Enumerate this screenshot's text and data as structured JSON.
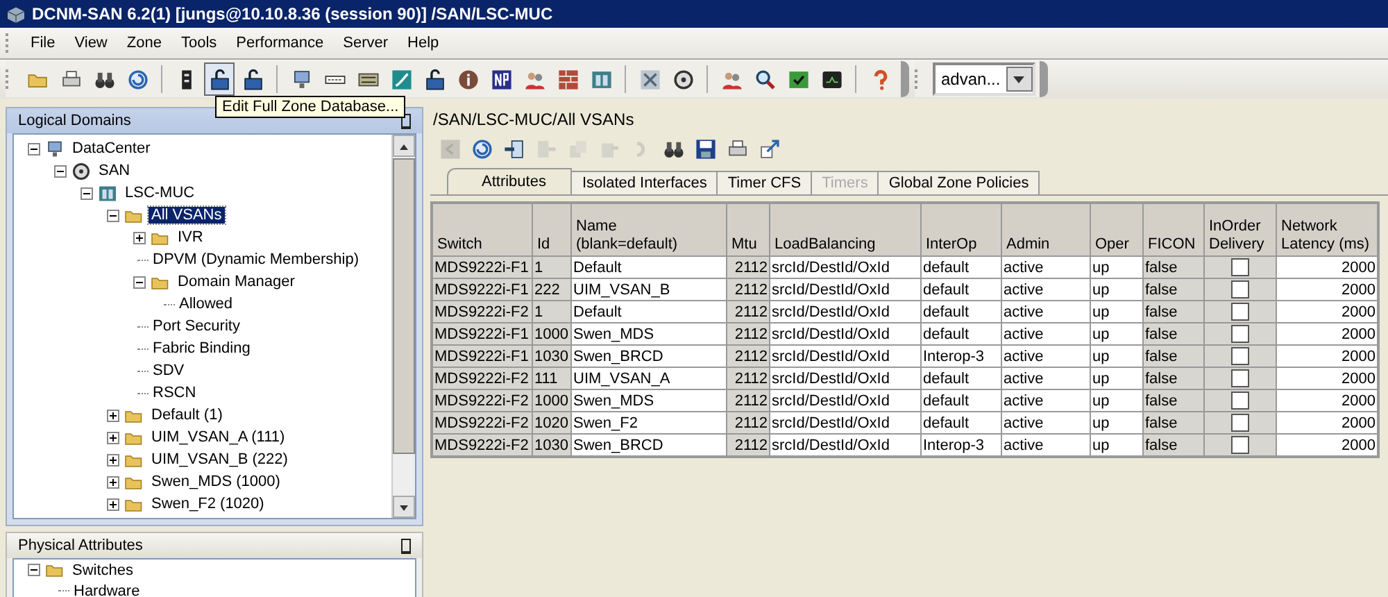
{
  "window": {
    "title": "DCNM-SAN 6.2(1) [jungs@10.10.8.36 (session 90)] /SAN/LSC-MUC"
  },
  "menu": [
    "File",
    "View",
    "Zone",
    "Tools",
    "Performance",
    "Server",
    "Help"
  ],
  "toolbar": {
    "groups": [
      [
        {
          "kind": "folder",
          "hovered": false
        },
        {
          "kind": "printer",
          "hovered": false
        },
        {
          "kind": "binoculars",
          "hovered": false
        },
        {
          "kind": "refresh",
          "hovered": false
        }
      ],
      [
        {
          "kind": "rack",
          "hovered": false
        },
        {
          "kind": "lock",
          "hovered": true
        },
        {
          "kind": "lock",
          "hovered": false
        }
      ],
      [
        {
          "kind": "computer",
          "hovered": false
        },
        {
          "kind": "switch",
          "hovered": false
        },
        {
          "kind": "cable",
          "hovered": false
        },
        {
          "kind": "link",
          "hovered": false
        },
        {
          "kind": "lock",
          "hovered": false
        },
        {
          "kind": "info",
          "hovered": false
        },
        {
          "kind": "np",
          "hovered": false
        },
        {
          "kind": "users",
          "hovered": false
        },
        {
          "kind": "wall",
          "hovered": false
        },
        {
          "kind": "cabinet",
          "hovered": false
        }
      ],
      [
        {
          "kind": "tools",
          "hovered": false
        },
        {
          "kind": "disk",
          "hovered": false
        }
      ],
      [
        {
          "kind": "users",
          "hovered": false
        },
        {
          "kind": "search",
          "hovered": false
        },
        {
          "kind": "check",
          "hovered": false
        },
        {
          "kind": "monitor",
          "hovered": false
        }
      ],
      [
        {
          "kind": "help",
          "hovered": false
        }
      ]
    ],
    "view_select": {
      "value": "advan..."
    }
  },
  "tooltip": "Edit Full Zone Database...",
  "logical_domains": {
    "title": "Logical Domains",
    "tree": [
      {
        "label": "DataCenter",
        "kind": "datacenter",
        "expanded": true,
        "selected": false,
        "children": [
          {
            "label": "SAN",
            "kind": "san",
            "expanded": true,
            "selected": false,
            "children": [
              {
                "label": "LSC-MUC",
                "kind": "fabric",
                "expanded": true,
                "selected": false,
                "children": [
                  {
                    "label": "All VSANs",
                    "kind": "folder",
                    "expanded": true,
                    "selected": true,
                    "children": [
                      {
                        "label": "IVR",
                        "kind": "folder",
                        "expanded": false,
                        "selected": false
                      },
                      {
                        "label": "DPVM (Dynamic Membership)",
                        "selected": false
                      },
                      {
                        "label": "Domain Manager",
                        "kind": "folder",
                        "expanded": true,
                        "selected": false,
                        "children": [
                          {
                            "label": "Allowed",
                            "selected": false
                          }
                        ]
                      },
                      {
                        "label": "Port Security",
                        "selected": false
                      },
                      {
                        "label": "Fabric Binding",
                        "selected": false
                      },
                      {
                        "label": "SDV",
                        "selected": false
                      },
                      {
                        "label": "RSCN",
                        "selected": false
                      }
                    ]
                  },
                  {
                    "label": "Default (1)",
                    "kind": "folder",
                    "expanded": false,
                    "selected": false
                  },
                  {
                    "label": "UIM_VSAN_A (111)",
                    "kind": "folder",
                    "expanded": false,
                    "selected": false
                  },
                  {
                    "label": "UIM_VSAN_B (222)",
                    "kind": "folder",
                    "expanded": false,
                    "selected": false
                  },
                  {
                    "label": "Swen_MDS (1000)",
                    "kind": "folder",
                    "expanded": false,
                    "selected": false
                  },
                  {
                    "label": "Swen_F2 (1020)",
                    "kind": "folder",
                    "expanded": false,
                    "selected": false
                  }
                ]
              }
            ]
          }
        ]
      }
    ]
  },
  "physical_attributes": {
    "title": "Physical Attributes",
    "tree": [
      {
        "label": "Switches",
        "kind": "folder",
        "expanded": true,
        "selected": false,
        "children": [
          {
            "label": "Hardware",
            "selected": false
          }
        ]
      }
    ]
  },
  "content": {
    "path": "/SAN/LSC-MUC/All VSANs",
    "toolbar": [
      {
        "kind": "back",
        "disabled": true
      },
      {
        "kind": "refresh",
        "disabled": false
      },
      {
        "kind": "insert",
        "disabled": false
      },
      {
        "kind": "export",
        "disabled": true
      },
      {
        "kind": "copy",
        "disabled": true
      },
      {
        "kind": "paste",
        "disabled": true
      },
      {
        "kind": "undo",
        "disabled": true
      },
      {
        "kind": "binoculars",
        "disabled": false
      },
      {
        "kind": "save",
        "disabled": false
      },
      {
        "kind": "printer",
        "disabled": false
      },
      {
        "kind": "detach",
        "disabled": false
      }
    ],
    "tabs": [
      {
        "label": "Attributes",
        "selected": true,
        "disabled": false
      },
      {
        "label": "Isolated Interfaces",
        "selected": false,
        "disabled": false
      },
      {
        "label": "Timer CFS",
        "selected": false,
        "disabled": false
      },
      {
        "label": "Timers",
        "selected": false,
        "disabled": true
      },
      {
        "label": "Global Zone Policies",
        "selected": false,
        "disabled": false
      }
    ],
    "table": {
      "columns": [
        "Switch",
        "Id",
        "Name (blank=default)",
        "Mtu",
        "LoadBalancing",
        "InterOp",
        "Admin",
        "Oper",
        "FICON",
        "InOrder Delivery",
        "Network Latency (ms)"
      ],
      "rows": [
        {
          "switch": "MDS9222i-F1",
          "id": "1",
          "name": "Default",
          "mtu": "2112",
          "load_balancing": "srcId/DestId/OxId",
          "interop": "default",
          "admin": "active",
          "oper": "up",
          "ficon": "false",
          "in_order_delivery": false,
          "network_latency": "2000"
        },
        {
          "switch": "MDS9222i-F1",
          "id": "222",
          "name": "UIM_VSAN_B",
          "mtu": "2112",
          "load_balancing": "srcId/DestId/OxId",
          "interop": "default",
          "admin": "active",
          "oper": "up",
          "ficon": "false",
          "in_order_delivery": false,
          "network_latency": "2000"
        },
        {
          "switch": "MDS9222i-F2",
          "id": "1",
          "name": "Default",
          "mtu": "2112",
          "load_balancing": "srcId/DestId/OxId",
          "interop": "default",
          "admin": "active",
          "oper": "up",
          "ficon": "false",
          "in_order_delivery": false,
          "network_latency": "2000"
        },
        {
          "switch": "MDS9222i-F1",
          "id": "1000",
          "name": "Swen_MDS",
          "mtu": "2112",
          "load_balancing": "srcId/DestId/OxId",
          "interop": "default",
          "admin": "active",
          "oper": "up",
          "ficon": "false",
          "in_order_delivery": false,
          "network_latency": "2000"
        },
        {
          "switch": "MDS9222i-F1",
          "id": "1030",
          "name": "Swen_BRCD",
          "mtu": "2112",
          "load_balancing": "srcId/DestId/OxId",
          "interop": "Interop-3",
          "admin": "active",
          "oper": "up",
          "ficon": "false",
          "in_order_delivery": false,
          "network_latency": "2000"
        },
        {
          "switch": "MDS9222i-F2",
          "id": "111",
          "name": "UIM_VSAN_A",
          "mtu": "2112",
          "load_balancing": "srcId/DestId/OxId",
          "interop": "default",
          "admin": "active",
          "oper": "up",
          "ficon": "false",
          "in_order_delivery": false,
          "network_latency": "2000"
        },
        {
          "switch": "MDS9222i-F2",
          "id": "1000",
          "name": "Swen_MDS",
          "mtu": "2112",
          "load_balancing": "srcId/DestId/OxId",
          "interop": "default",
          "admin": "active",
          "oper": "up",
          "ficon": "false",
          "in_order_delivery": false,
          "network_latency": "2000"
        },
        {
          "switch": "MDS9222i-F2",
          "id": "1020",
          "name": "Swen_F2",
          "mtu": "2112",
          "load_balancing": "srcId/DestId/OxId",
          "interop": "default",
          "admin": "active",
          "oper": "up",
          "ficon": "false",
          "in_order_delivery": false,
          "network_latency": "2000"
        },
        {
          "switch": "MDS9222i-F2",
          "id": "1030",
          "name": "Swen_BRCD",
          "mtu": "2112",
          "load_balancing": "srcId/DestId/OxId",
          "interop": "Interop-3",
          "admin": "active",
          "oper": "up",
          "ficon": "false",
          "in_order_delivery": false,
          "network_latency": "2000"
        }
      ]
    }
  }
}
